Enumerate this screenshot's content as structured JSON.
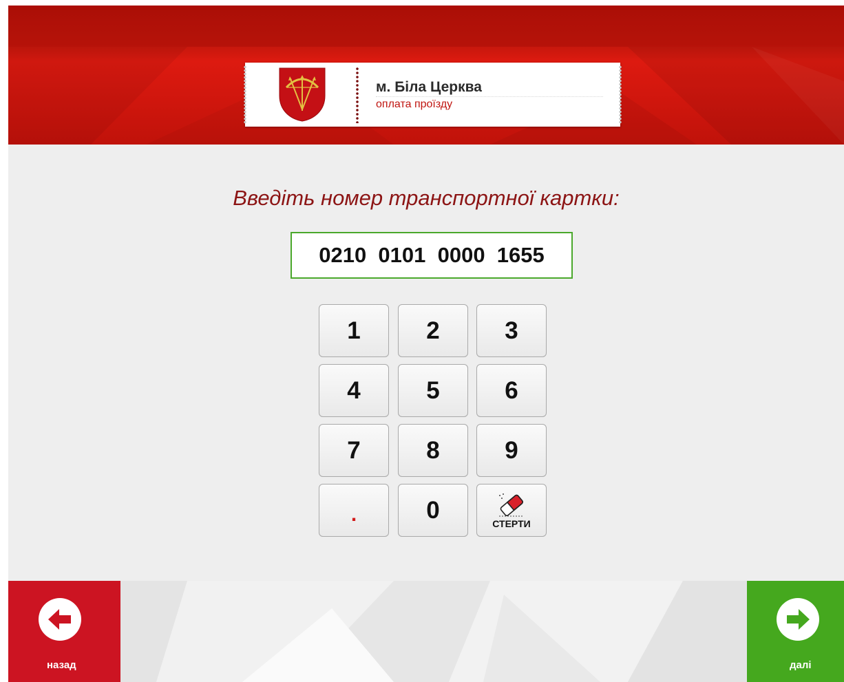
{
  "header": {
    "city": "м. Біла Церква",
    "service": "оплата проїзду",
    "crest_icon": "coat-of-arms-icon"
  },
  "prompt": "Введіть номер транспортної картки:",
  "card_input": {
    "value": "0210  0101  0000  1655"
  },
  "keypad": {
    "keys": [
      "1",
      "2",
      "3",
      "4",
      "5",
      "6",
      "7",
      "8",
      "9",
      ".",
      "0"
    ],
    "erase_label": "СТЕРТИ",
    "erase_icon": "eraser-icon"
  },
  "footer": {
    "back_label": "назад",
    "back_icon": "arrow-left-icon",
    "next_label": "далі",
    "next_icon": "arrow-right-icon"
  },
  "colors": {
    "header_red": "#cf160d",
    "prompt_red": "#8c1414",
    "back_red": "#cc1422",
    "next_green": "#45a81e",
    "input_border": "#4aa82b"
  }
}
